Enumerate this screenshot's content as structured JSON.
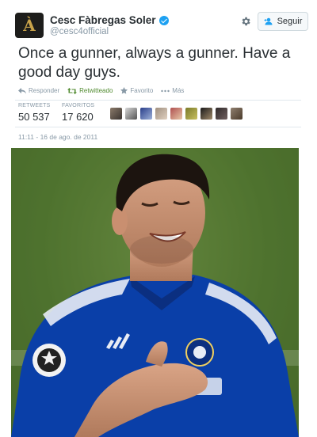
{
  "user": {
    "avatar_glyph": "À",
    "name": "Cesc Fàbregas Soler",
    "handle": "@cesc4official",
    "verified": true
  },
  "header": {
    "follow_label": "Seguir",
    "gear_icon": "gear-icon"
  },
  "tweet": {
    "text": "Once a gunner, always a gunner. Have a good day guys."
  },
  "actions": {
    "reply": "Responder",
    "retweet": "Retwitteado",
    "favorite": "Favorito",
    "more": "Más"
  },
  "stats": {
    "retweets_label": "RETWEETS",
    "retweets_value": "50 537",
    "favorites_label": "FAVORITOS",
    "favorites_value": "17 620"
  },
  "timestamp": "11:11 - 16 de ago. de 2011",
  "colors": {
    "retweet_active": "#4f8a2e",
    "verified": "#1da1f2",
    "kit_blue": "#0a3fa8"
  }
}
